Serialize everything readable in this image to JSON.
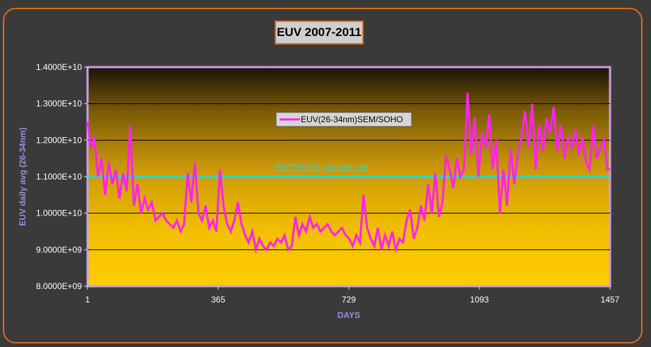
{
  "chart_data": {
    "type": "line",
    "title": "EUV 2007-2011",
    "xlabel": "DAYS",
    "ylabel": "EUV daily avg (26-34nm)",
    "xlim": [
      1,
      1457
    ],
    "ylim": [
      8000000000,
      14000000000
    ],
    "y_ticks": [
      "8.0000E+09",
      "9.0000E+09",
      "1.0000E+10",
      "1.1000E+10",
      "1.2000E+10",
      "1.3000E+10",
      "1.4000E+10"
    ],
    "y_tick_values": [
      8000000000,
      9000000000,
      10000000000,
      11000000000,
      12000000000,
      13000000000,
      14000000000
    ],
    "x_ticks": [
      "1",
      "365",
      "729",
      "1093",
      "1457"
    ],
    "x_tick_values": [
      1,
      365,
      729,
      1093,
      1457
    ],
    "grid": true,
    "legend_position": "center-top",
    "series": [
      {
        "name": "EUV(26-34nm)SEM/SOHO",
        "color": "#ff22ee",
        "x": [
          1,
          10,
          20,
          30,
          40,
          50,
          60,
          70,
          80,
          90,
          100,
          110,
          120,
          130,
          140,
          150,
          160,
          170,
          180,
          190,
          200,
          210,
          220,
          230,
          240,
          250,
          260,
          270,
          280,
          290,
          300,
          310,
          320,
          330,
          340,
          350,
          360,
          370,
          380,
          390,
          400,
          410,
          420,
          430,
          440,
          450,
          460,
          470,
          480,
          490,
          500,
          510,
          520,
          530,
          540,
          550,
          560,
          570,
          580,
          590,
          600,
          610,
          620,
          630,
          640,
          650,
          660,
          670,
          680,
          690,
          700,
          710,
          720,
          730,
          740,
          750,
          760,
          770,
          780,
          790,
          800,
          810,
          820,
          830,
          840,
          850,
          860,
          870,
          880,
          890,
          900,
          910,
          920,
          930,
          940,
          950,
          960,
          970,
          980,
          990,
          1000,
          1010,
          1020,
          1030,
          1040,
          1050,
          1060,
          1070,
          1080,
          1090,
          1100,
          1110,
          1120,
          1130,
          1140,
          1150,
          1160,
          1170,
          1180,
          1190,
          1200,
          1210,
          1220,
          1230,
          1240,
          1250,
          1260,
          1270,
          1280,
          1290,
          1300,
          1310,
          1320,
          1330,
          1340,
          1350,
          1360,
          1370,
          1380,
          1390,
          1400,
          1410,
          1420,
          1430,
          1440,
          1450,
          1457
        ],
        "values": [
          12500000000,
          11800000000,
          12100000000,
          11000000000,
          11500000000,
          10500000000,
          11400000000,
          10800000000,
          11200000000,
          10400000000,
          11100000000,
          10600000000,
          12400000000,
          10200000000,
          10800000000,
          10000000000,
          10400000000,
          10100000000,
          10300000000,
          9800000000,
          9900000000,
          10000000000,
          9800000000,
          9700000000,
          9600000000,
          9800000000,
          9500000000,
          9700000000,
          11100000000,
          10300000000,
          11400000000,
          10000000000,
          9800000000,
          10200000000,
          9600000000,
          9800000000,
          9500000000,
          11200000000,
          10200000000,
          9700000000,
          9500000000,
          9800000000,
          10300000000,
          9700000000,
          9400000000,
          9200000000,
          9500000000,
          9000000000,
          9300000000,
          9100000000,
          9000000000,
          9200000000,
          9100000000,
          9300000000,
          9200000000,
          9400000000,
          9000000000,
          9100000000,
          9900000000,
          9400000000,
          9700000000,
          9500000000,
          9900000000,
          9600000000,
          9700000000,
          9500000000,
          9600000000,
          9700000000,
          9500000000,
          9400000000,
          9500000000,
          9600000000,
          9400000000,
          9300000000,
          9100000000,
          9400000000,
          9200000000,
          10500000000,
          9600000000,
          9300000000,
          9100000000,
          9600000000,
          9000000000,
          9400000000,
          9100000000,
          9500000000,
          9000000000,
          9300000000,
          9200000000,
          9800000000,
          10100000000,
          9300000000,
          9600000000,
          10200000000,
          9800000000,
          10800000000,
          10000000000,
          11100000000,
          9900000000,
          10300000000,
          11600000000,
          11200000000,
          10700000000,
          11500000000,
          11000000000,
          11200000000,
          13300000000,
          11600000000,
          12600000000,
          11000000000,
          12200000000,
          11800000000,
          12700000000,
          11200000000,
          12000000000,
          10000000000,
          11200000000,
          10200000000,
          11800000000,
          10800000000,
          11600000000,
          12100000000,
          12800000000,
          11800000000,
          13000000000,
          11200000000,
          12400000000,
          11700000000,
          12600000000,
          12200000000,
          12900000000,
          11700000000,
          12400000000,
          11500000000,
          12100000000,
          11800000000,
          12300000000,
          11600000000,
          12100000000,
          11400000000,
          11200000000,
          12400000000,
          11500000000,
          11800000000,
          12000000000,
          11200000000,
          11200000000
        ]
      }
    ],
    "reference_line": {
      "value": 11000000000,
      "color": "#22d8d8"
    },
    "annotation": "SC22/23 minimum"
  }
}
